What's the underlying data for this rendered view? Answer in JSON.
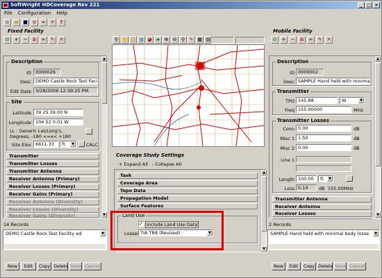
{
  "window": {
    "title": "SoftWright HDCoverage Rev 221",
    "min": "_",
    "max": "□",
    "close": "×"
  },
  "menu": [
    "File",
    "Configuration",
    "Help"
  ],
  "toolbar_icons": [
    "new-icon",
    "open-icon",
    "save-icon",
    "chart-icon",
    "binoculars-icon",
    "delete-icon",
    "help-icon"
  ],
  "fixed": {
    "title": "Fixed Facility",
    "description_header": "Description",
    "id_label": "ID",
    "id_value": "0000026",
    "desc_label": "Desc",
    "desc_value": "DEMO Castle Rock Test Facilit",
    "edit_label": "Edit Date",
    "edit_value": "3/28/2006 12:39:25 PM",
    "site_header": "Site",
    "lat_label": "Latitude",
    "lat_value": "39 25 39.00 N",
    "lon_label": "Longitude",
    "lon_value": "104 52 0.01 W",
    "ll_text": "LL : Generic Lat/Long's, Degrees, -180 <=x< +180",
    "elev_label": "Site Elev",
    "elev_value": "6611.33",
    "elev_unit": "ft",
    "calc_label": "CALC",
    "sections": [
      "Transmitter",
      "Transmitter Losses",
      "Transmitter Antenna",
      "Receiver Antenna (Primary)",
      "Receiver Losses (Primary)",
      "Receiver Gains (Primary)",
      "Receiver Antenna (Diversity)",
      "Receiver Losses (Diversity)",
      "Receiver Gains (Diversity)"
    ],
    "records": "14 Records",
    "selected_record": "DEMO Castle Rock Test Facility ed"
  },
  "mobile": {
    "title": "Mobile Facility",
    "description_header": "Description",
    "id_label": "ID",
    "id_value": "0000002",
    "desc_label": "Desc",
    "desc_value": "SAMPLE Hand held with minimal bo",
    "tx_header": "Transmitter",
    "tpo_label": "TPO",
    "tpo_value": "145.88",
    "tpo_unit": "W",
    "freq_label": "Freq",
    "freq_value": "155.00000",
    "freq_unit": "MHz",
    "txloss_header": "Transmitter Losses",
    "conn_label": "Conn",
    "conn_value": "0.00",
    "conn_unit": "dB",
    "misc1_label": "Misc 1",
    "misc1_value": "1.50",
    "misc1_unit": "dB",
    "misc2_label": "Misc 2",
    "misc2_value": "0.00",
    "misc2_unit": "dB",
    "line1_label": "Line 1",
    "length_label": "Length",
    "length_value": "100.00",
    "length_unit": "ft",
    "loss_label": "Loss",
    "loss_value": "0.14",
    "loss_unit": "dB",
    "loss_freq": "155.00MHz",
    "sections": [
      "Transmitter Antenna",
      "Receiver Antenna",
      "Receiver Losses",
      "Receiver Gains"
    ],
    "records": "2 Records",
    "selected_record": "SAMPLE Hand held with minimal body losse"
  },
  "study": {
    "title": "Coverage Study Settings",
    "expand": "+ Expand All",
    "collapse": "- Collapse All",
    "sections": [
      "Task",
      "Coverage Area",
      "Topo Data",
      "Propagation Model",
      "Surface Features"
    ],
    "land_use_header": "Land Use",
    "include_label": "Include Land Use Data",
    "include_checked": true,
    "losses_label": "Losses",
    "losses_value": "TIA TR8 (Revised)"
  },
  "buttons": [
    "New",
    "Edit",
    "Copy",
    "Delete",
    "Save",
    "Cancel"
  ],
  "colors": {
    "title_bar": "#0a246a",
    "highlight": "#e00000",
    "roads": "#d40000",
    "map_bg": "#ffffff"
  }
}
